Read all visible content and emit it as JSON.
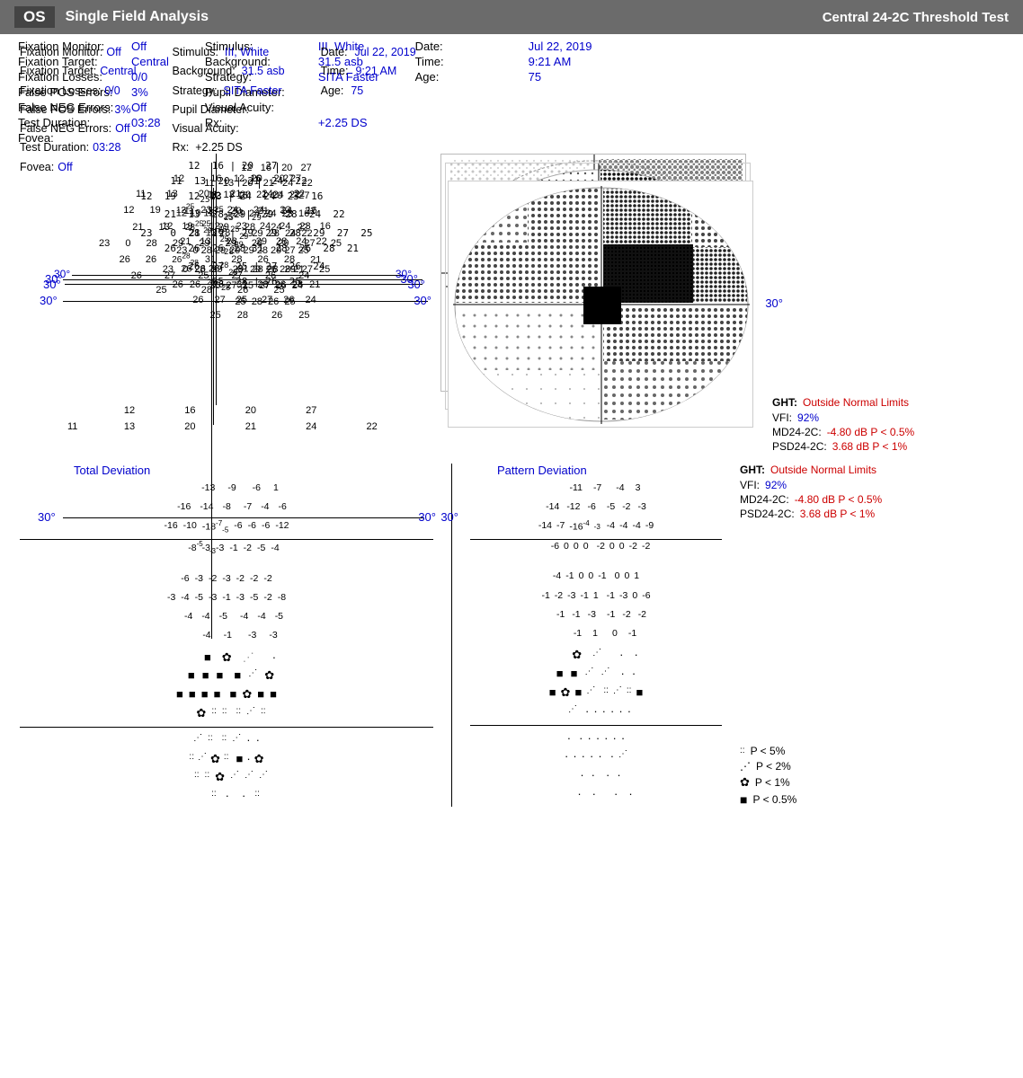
{
  "header": {
    "eye_label": "OS",
    "title": "Single Field Analysis",
    "test_type": "Central 24-2C Threshold Test"
  },
  "patient_info": {
    "fixation_monitor_label": "Fixation Monitor:",
    "fixation_monitor_value": "Off",
    "fixation_target_label": "Fixation Target:",
    "fixation_target_value": "Central",
    "fixation_losses_label": "Fixation Losses:",
    "fixation_losses_value": "0/0",
    "false_pos_label": "False POS Errors:",
    "false_pos_value": "3%",
    "false_neg_label": "False NEG Errors:",
    "false_neg_value": "Off",
    "test_duration_label": "Test Duration:",
    "test_duration_value": "03:28",
    "fovea_label": "Fovea:",
    "fovea_value": "Off"
  },
  "stimulus_info": {
    "stimulus_label": "Stimulus:",
    "stimulus_value": "III, White",
    "background_label": "Background:",
    "background_value": "31.5 asb",
    "strategy_label": "Strategy:",
    "strategy_value": "SITA Faster",
    "pupil_label": "Pupil Diameter:",
    "pupil_value": "",
    "visual_acuity_label": "Visual Acuity:",
    "visual_acuity_value": "",
    "rx_label": "Rx:",
    "rx_value": "+2.25 DS"
  },
  "date_info": {
    "date_label": "Date:",
    "date_value": "Jul 22, 2019",
    "time_label": "Time:",
    "time_value": "9:21 AM",
    "age_label": "Age:",
    "age_value": "75"
  },
  "statistics": {
    "ght_label": "GHT:",
    "ght_value": "Outside Normal Limits",
    "vfi_label": "VFI:",
    "vfi_value": "92%",
    "md_label": "MD24-2C:",
    "md_value": "-4.80 dB P < 0.5%",
    "psd_label": "PSD24-2C:",
    "psd_value": "3.68 dB P < 1%"
  },
  "legend": {
    "p5_symbol": "::",
    "p5_label": "P < 5%",
    "p2_symbol": "≋",
    "p2_label": "P < 2%",
    "p1_symbol": "✿",
    "p1_label": "P < 1%",
    "p05_label": "P < 0.5%"
  },
  "axis_labels": {
    "left_30": "30°",
    "right_30": "30°"
  },
  "total_deviation_title": "Total Deviation",
  "pattern_deviation_title": "Pattern Deviation"
}
